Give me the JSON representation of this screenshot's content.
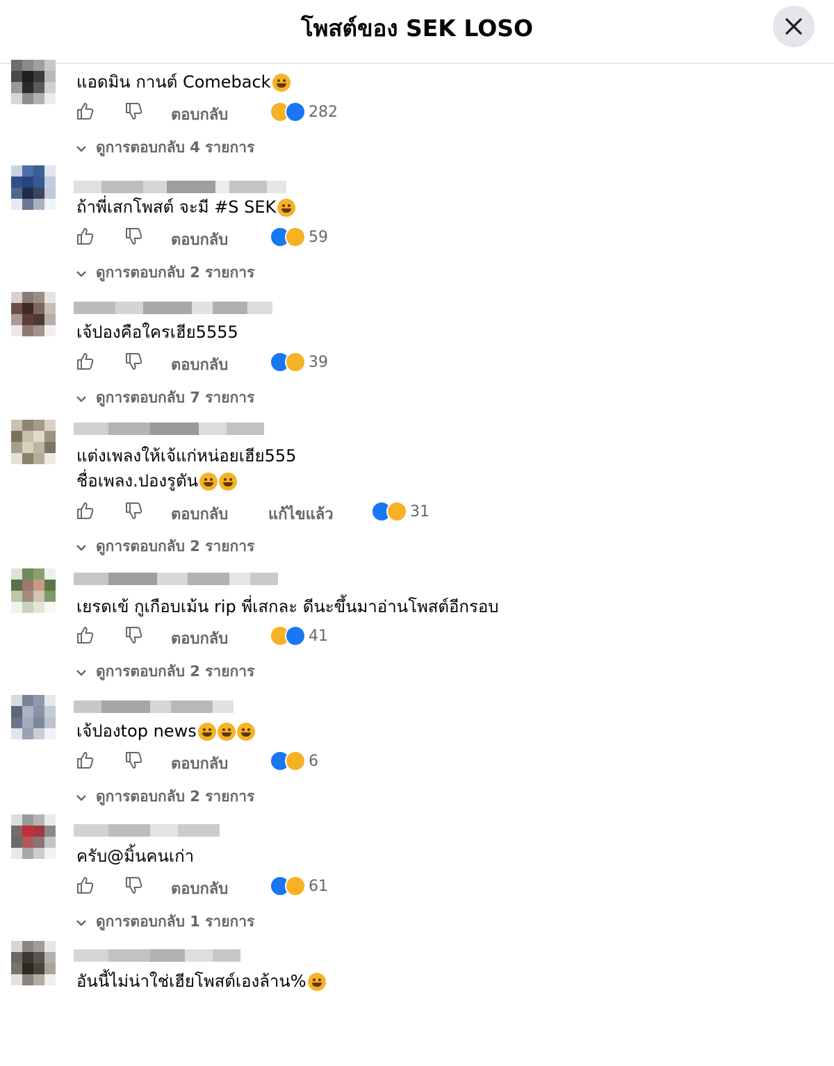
{
  "header": {
    "title": "โพสต์ของ SEK LOSO",
    "close_icon": "close-icon"
  },
  "labels": {
    "reply": "ตอบกลับ",
    "edited": "แก้ไขแล้ว"
  },
  "colors": {
    "like_blue": "#1877f2",
    "haha_yellow": "#f7b125",
    "meta_gray": "#65676b",
    "close_bg": "#e4e6eb"
  },
  "comments": [
    {
      "text": "แอดมิน กานต์ Comeback",
      "emojis": [
        "grinning-sweat-emoji"
      ],
      "reactions": [
        "haha",
        "like"
      ],
      "count": "282",
      "replies": "ดูการตอบกลับ 4 รายการ"
    },
    {
      "text": "ถ้าพี่เสกโพสต์ จะมี #S SEK",
      "emojis": [
        "laughing-emoji"
      ],
      "reactions": [
        "like",
        "haha"
      ],
      "count": "59",
      "replies": "ดูการตอบกลับ 2 รายการ"
    },
    {
      "text": "เจ้ปองคือใครเฮีย5555",
      "emojis": [],
      "reactions": [
        "like",
        "haha"
      ],
      "count": "39",
      "replies": "ดูการตอบกลับ 7 รายการ"
    },
    {
      "text": "แต่งเพลงให้เจ้แก่หน่อยเฮีย555",
      "text2": "ชื่อเพลง.ปองรูตัน",
      "emojis2": [
        "grin-emoji",
        "grin-emoji"
      ],
      "edited": true,
      "reactions": [
        "like",
        "haha"
      ],
      "count": "31",
      "replies": "ดูการตอบกลับ 2 รายการ"
    },
    {
      "text": "เยรดเข้ กูเกือบเม้น rip พี่เสกละ ดีนะขึ้นมาอ่านโพสต์อีกรอบ",
      "emojis": [],
      "reactions": [
        "haha",
        "like"
      ],
      "count": "41",
      "replies": "ดูการตอบกลับ 2 รายการ"
    },
    {
      "text": "เจ้ปองtop news",
      "emojis": [
        "rofl-emoji",
        "rofl-emoji",
        "rofl-emoji"
      ],
      "reactions": [
        "like",
        "haha"
      ],
      "count": "6",
      "replies": "ดูการตอบกลับ 2 รายการ"
    },
    {
      "text": "ครับ@มิ้นคนเก่า",
      "emojis": [],
      "reactions": [
        "like",
        "haha"
      ],
      "count": "61",
      "replies": "ดูการตอบกลับ 1 รายการ"
    },
    {
      "text": "อันนี้ไม่น่าใช่เฮียโพสต์เองล้าน%",
      "emojis": [
        "grinning-sweat-emoji"
      ]
    }
  ]
}
